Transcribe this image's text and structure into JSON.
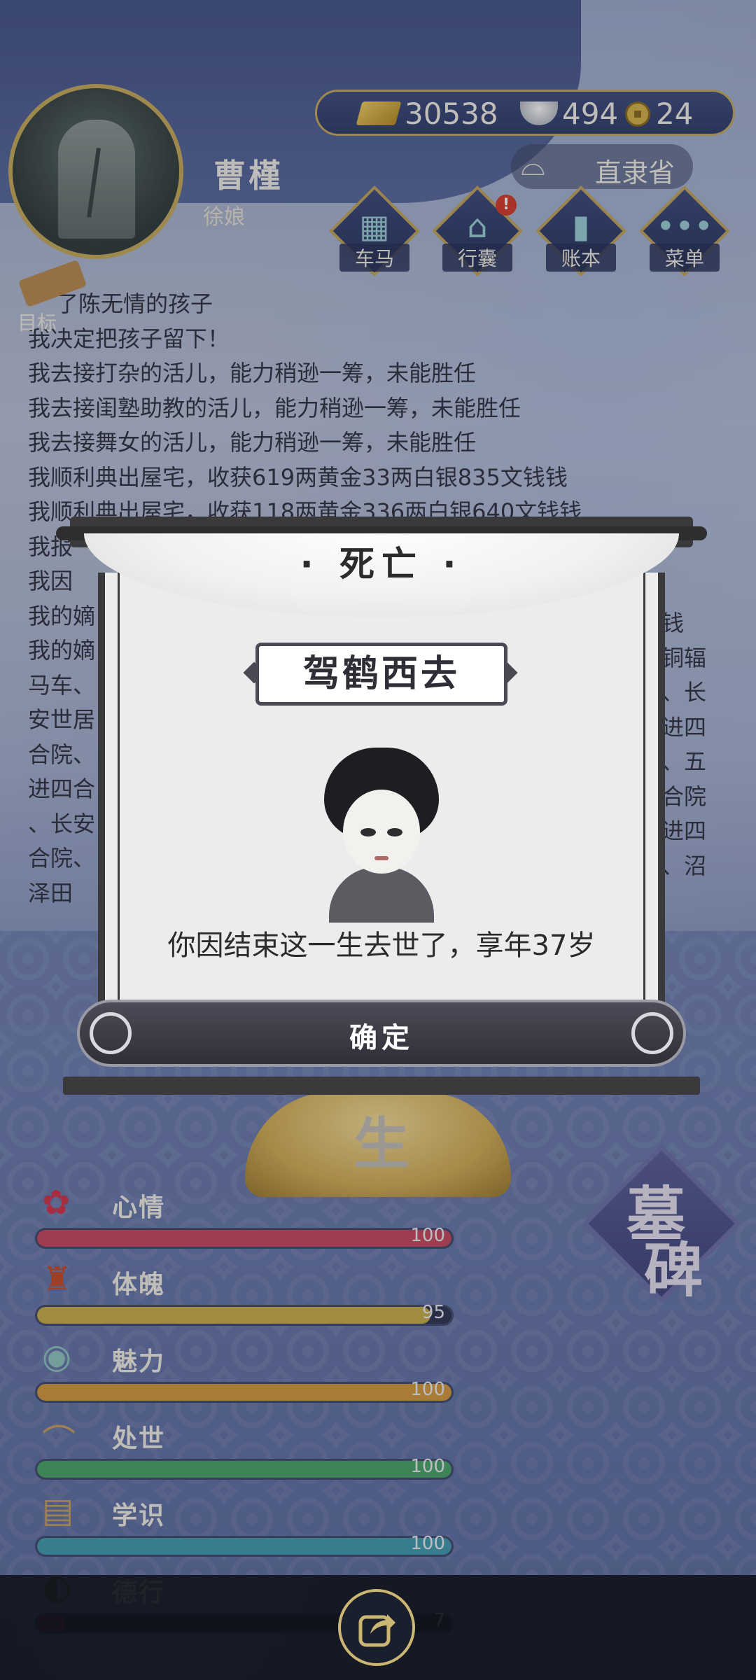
{
  "player": {
    "name": "曹槿",
    "title": "徐娘"
  },
  "currency": {
    "gold": "30538",
    "silver": "494",
    "coins": "24"
  },
  "location": "直隶省",
  "nav": [
    {
      "label": "车马",
      "icon": "carriage-icon"
    },
    {
      "label": "行囊",
      "icon": "bag-icon",
      "badge": "!"
    },
    {
      "label": "账本",
      "icon": "ledger-icon"
    },
    {
      "label": "菜单",
      "icon": "menu-icon"
    }
  ],
  "goal_label": "目标",
  "log": [
    "了陈无情的孩子",
    "我决定把孩子留下！",
    "我去接打杂的活儿，能力稍逊一筹，未能胜任",
    "我去接闺塾助教的活儿，能力稍逊一筹，未能胜任",
    "我去接舞女的活儿，能力稍逊一筹，未能胜任",
    "我顺利典出屋宅，收获619两黄金33两白银835文钱钱",
    "我顺利典出屋宅，收获118两黄金336两白银640文钱钱",
    "我报",
    "我因",
    "我的嫡",
    "我的嫡",
    "马车、",
    "安世居",
    "合院、",
    "进四合",
    "、长安",
    "合院、",
    "泽田"
  ],
  "log_right": [
    "钱",
    "铜辐",
    "、长",
    "进四",
    "、五",
    "合院",
    "进四",
    "、沼"
  ],
  "stats": [
    {
      "name": "心情",
      "value": 100,
      "display": "100",
      "color": "#c7485d"
    },
    {
      "name": "体魄",
      "value": 95,
      "display": "95",
      "color": "#c8b046"
    },
    {
      "name": "魅力",
      "value": 100,
      "display": "100",
      "color": "#d49a3c"
    },
    {
      "name": "处世",
      "value": 100,
      "display": "100",
      "color": "#4aa56a"
    },
    {
      "name": "学识",
      "value": 100,
      "display": "100",
      "color": "#3f9bb0"
    },
    {
      "name": "德行",
      "value": 7,
      "display": "7",
      "color": "#7a2f6a"
    }
  ],
  "center_char": "生",
  "tomb_button": {
    "line1": "墓",
    "line2": "碑"
  },
  "modal": {
    "title": "死亡",
    "subtitle": "驾鹤西去",
    "message": "你因结束这一生去世了，享年37岁",
    "confirm": "确定"
  }
}
